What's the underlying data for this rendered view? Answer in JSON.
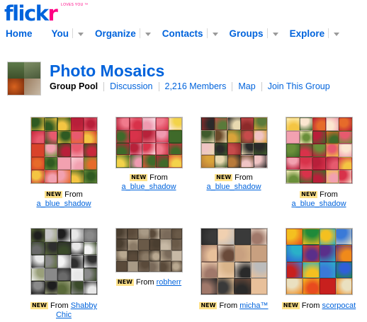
{
  "brand": {
    "wordmark_main": "flick",
    "wordmark_accent": "r",
    "tagline": "LOVES YOU ™"
  },
  "nav": [
    {
      "label": "Home",
      "has_menu": false
    },
    {
      "label": "You",
      "has_menu": true
    },
    {
      "label": "Organize",
      "has_menu": true
    },
    {
      "label": "Contacts",
      "has_menu": true
    },
    {
      "label": "Groups",
      "has_menu": true
    },
    {
      "label": "Explore",
      "has_menu": true
    }
  ],
  "group": {
    "title": "Photo Mosaics",
    "current": "Group Pool",
    "links": [
      "Discussion",
      "2,216 Members",
      "Map",
      "Join This Group"
    ]
  },
  "badge_text": "NEW",
  "from_text": "From",
  "tiles": [
    {
      "author_line1": "a_blue_shadow",
      "author_line2": ""
    },
    {
      "author_line1": "a_blue_shadow",
      "author_line2": ""
    },
    {
      "author_line1": "a_blue_shadow",
      "author_line2": ""
    },
    {
      "author_line1": "a_blue_shadow",
      "author_line2": ""
    },
    {
      "author_line1": "Shabby",
      "author_line2": "Chic"
    },
    {
      "author_line1": "robherr",
      "author_line2": ""
    },
    {
      "author_line1": "micha™",
      "author_line2": ""
    },
    {
      "author_line1": "scorpocat",
      "author_line2": ""
    }
  ],
  "colors": {
    "link": "#0063dc",
    "accent": "#ff0084",
    "badge": "#ffe28a"
  }
}
